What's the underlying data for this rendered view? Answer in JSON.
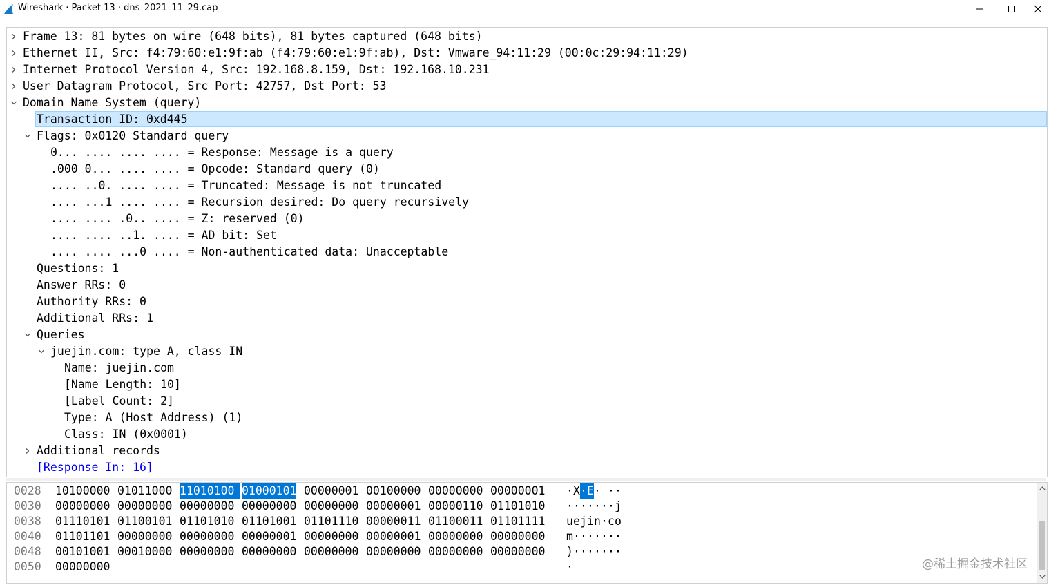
{
  "window": {
    "title": "Wireshark · Packet 13 · dns_2021_11_29.cap",
    "controls": [
      "minimize",
      "maximize",
      "close"
    ]
  },
  "tree": [
    {
      "text": "Frame 13: 81 bytes on wire (648 bits), 81 bytes captured (648 bits)",
      "arrow": "collapsed"
    },
    {
      "text": "Ethernet II, Src: f4:79:60:e1:9f:ab (f4:79:60:e1:9f:ab), Dst: Vmware_94:11:29 (00:0c:29:94:11:29)",
      "arrow": "collapsed"
    },
    {
      "text": "Internet Protocol Version 4, Src: 192.168.8.159, Dst: 192.168.10.231",
      "arrow": "collapsed"
    },
    {
      "text": "User Datagram Protocol, Src Port: 42757, Dst Port: 53",
      "arrow": "collapsed"
    },
    {
      "text": "Domain Name System (query)",
      "arrow": "expanded"
    },
    {
      "text": "Transaction ID: 0xd445",
      "arrow": "none",
      "selected": true
    },
    {
      "text": "Flags: 0x0120 Standard query",
      "arrow": "expanded"
    },
    {
      "text": "0... .... .... .... = Response: Message is a query",
      "arrow": "none"
    },
    {
      "text": ".000 0... .... .... = Opcode: Standard query (0)",
      "arrow": "none"
    },
    {
      "text": ".... ..0. .... .... = Truncated: Message is not truncated",
      "arrow": "none"
    },
    {
      "text": ".... ...1 .... .... = Recursion desired: Do query recursively",
      "arrow": "none"
    },
    {
      "text": ".... .... .0.. .... = Z: reserved (0)",
      "arrow": "none"
    },
    {
      "text": ".... .... ..1. .... = AD bit: Set",
      "arrow": "none"
    },
    {
      "text": ".... .... ...0 .... = Non-authenticated data: Unacceptable",
      "arrow": "none"
    },
    {
      "text": "Questions: 1",
      "arrow": "none"
    },
    {
      "text": "Answer RRs: 0",
      "arrow": "none"
    },
    {
      "text": "Authority RRs: 0",
      "arrow": "none"
    },
    {
      "text": "Additional RRs: 1",
      "arrow": "none"
    },
    {
      "text": "Queries",
      "arrow": "expanded"
    },
    {
      "text": "juejin.com: type A, class IN",
      "arrow": "expanded"
    },
    {
      "text": "Name: juejin.com",
      "arrow": "none"
    },
    {
      "text": "[Name Length: 10]",
      "arrow": "none"
    },
    {
      "text": "[Label Count: 2]",
      "arrow": "none"
    },
    {
      "text": "Type: A (Host Address) (1)",
      "arrow": "none"
    },
    {
      "text": "Class: IN (0x0001)",
      "arrow": "none"
    },
    {
      "text": "Additional records",
      "arrow": "collapsed"
    },
    {
      "text": "[Response In: 16]",
      "arrow": "none",
      "link": true
    }
  ],
  "hex": [
    {
      "offset": "0028",
      "bytes": [
        "10100000",
        "01011000",
        "11010100",
        "01000101",
        "00000001",
        "00100000",
        "00000000",
        "00000001"
      ],
      "ascii": [
        "·",
        "X",
        "·",
        "E",
        "·",
        " ",
        "·",
        "·"
      ],
      "highlight": [
        2,
        3
      ]
    },
    {
      "offset": "0030",
      "bytes": [
        "00000000",
        "00000000",
        "00000000",
        "00000000",
        "00000000",
        "00000001",
        "00000110",
        "01101010"
      ],
      "ascii": [
        "·",
        "·",
        "·",
        "·",
        "·",
        "·",
        "·",
        "j"
      ],
      "highlight": []
    },
    {
      "offset": "0038",
      "bytes": [
        "01110101",
        "01100101",
        "01101010",
        "01101001",
        "01101110",
        "00000011",
        "01100011",
        "01101111"
      ],
      "ascii": [
        "u",
        "e",
        "j",
        "i",
        "n",
        "·",
        "c",
        "o"
      ],
      "highlight": []
    },
    {
      "offset": "0040",
      "bytes": [
        "01101101",
        "00000000",
        "00000000",
        "00000001",
        "00000000",
        "00000001",
        "00000000",
        "00000000"
      ],
      "ascii": [
        "m",
        "·",
        "·",
        "·",
        "·",
        "·",
        "·",
        "·"
      ],
      "highlight": []
    },
    {
      "offset": "0048",
      "bytes": [
        "00101001",
        "00010000",
        "00000000",
        "00000000",
        "00000000",
        "00000000",
        "00000000",
        "00000000"
      ],
      "ascii": [
        ")",
        "·",
        "·",
        "·",
        "·",
        "·",
        "·",
        "·"
      ],
      "highlight": []
    },
    {
      "offset": "0050",
      "bytes": [
        "00000000"
      ],
      "ascii": [
        "·"
      ],
      "highlight": []
    }
  ],
  "watermark": "@稀土掘金技术社区",
  "colors": {
    "selection": "#cce8ff",
    "hex_highlight": "#0078d7",
    "link": "#0000ee"
  }
}
